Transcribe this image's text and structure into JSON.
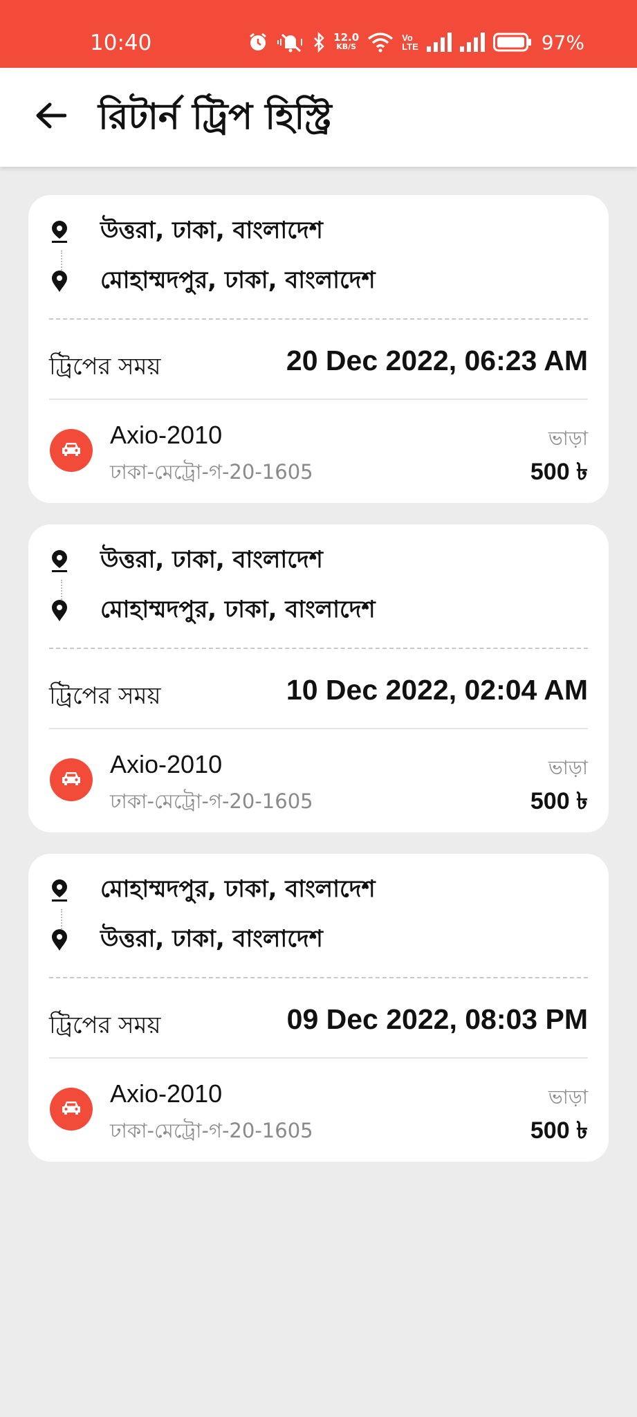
{
  "status_bar": {
    "time": "10:40",
    "net_speed_value": "12.0",
    "net_speed_unit": "KB/S",
    "volte_top": "Vo",
    "volte_bottom": "LTE",
    "battery_percent": "97%",
    "icons": [
      "alarm-icon",
      "mute-icon",
      "bluetooth-icon",
      "wifi-icon",
      "signal-icon",
      "signal-icon",
      "battery-icon"
    ]
  },
  "header": {
    "title": "রিটার্ন ট্রিপ হিস্ট্রি",
    "back_icon": "arrow-left-icon"
  },
  "colors": {
    "accent": "#f24b3a",
    "background": "#ececec",
    "card": "#ffffff",
    "muted_text": "#8a8a8a"
  },
  "trips": [
    {
      "pickup": "উত্তরা, ঢাকা, বাংলাদেশ",
      "dropoff": "মোহাম্মদপুর, ঢাকা, বাংলাদেশ",
      "time_label": "ট্রিপের সময়",
      "time": "20 Dec 2022, 06:23 AM",
      "vehicle_model": "Axio-2010",
      "vehicle_plate": "ঢাকা-মেট্রো-গ-20-1605",
      "fare_label": "ভাড়া",
      "fare": "500 ৳"
    },
    {
      "pickup": "উত্তরা, ঢাকা, বাংলাদেশ",
      "dropoff": "মোহাম্মদপুর, ঢাকা, বাংলাদেশ",
      "time_label": "ট্রিপের সময়",
      "time": "10 Dec 2022, 02:04 AM",
      "vehicle_model": "Axio-2010",
      "vehicle_plate": "ঢাকা-মেট্রো-গ-20-1605",
      "fare_label": "ভাড়া",
      "fare": "500 ৳"
    },
    {
      "pickup": "মোহাম্মদপুর, ঢাকা, বাংলাদেশ",
      "dropoff": "উত্তরা, ঢাকা, বাংলাদেশ",
      "time_label": "ট্রিপের সময়",
      "time": "09 Dec 2022, 08:03 PM",
      "vehicle_model": "Axio-2010",
      "vehicle_plate": "ঢাকা-মেট্রো-গ-20-1605",
      "fare_label": "ভাড়া",
      "fare": "500 ৳"
    }
  ]
}
